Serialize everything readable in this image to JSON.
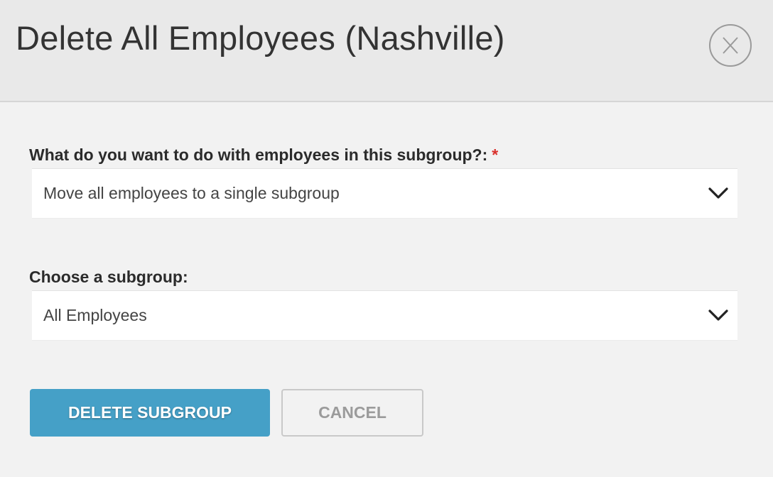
{
  "modal": {
    "title": "Delete All Employees (Nashville)",
    "close_icon": "close-x-circle-icon"
  },
  "form": {
    "action_field": {
      "label": "What do you want to do with employees in this subgroup?:",
      "required_mark": "*",
      "selected": "Move all employees to a single subgroup",
      "icon": "chevron-down-icon"
    },
    "subgroup_field": {
      "label": "Choose a subgroup:",
      "selected": "All Employees",
      "icon": "chevron-down-icon"
    }
  },
  "buttons": {
    "delete_label": "DELETE SUBGROUP",
    "cancel_label": "CANCEL"
  },
  "colors": {
    "header_bg": "#e9e9e9",
    "body_bg": "#f2f2f2",
    "primary": "#45a0c7",
    "required": "#d9302c",
    "muted": "#9b9b9b"
  }
}
